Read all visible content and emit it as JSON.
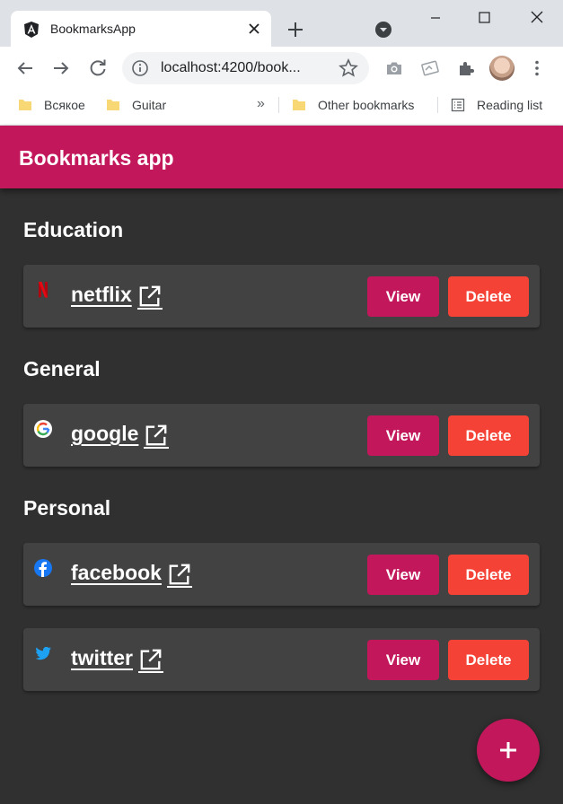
{
  "browser": {
    "tab_title": "BookmarksApp",
    "url": "localhost:4200/book...",
    "bookmarks_bar": [
      {
        "label": "Всякое",
        "icon": "folder-icon"
      },
      {
        "label": "Guitar",
        "icon": "folder-icon"
      },
      {
        "label": "Other bookmarks",
        "icon": "folder-icon"
      },
      {
        "label": "Reading list",
        "icon": "reading-list-icon"
      }
    ],
    "overflow_label": "»"
  },
  "app": {
    "title": "Bookmarks app",
    "colors": {
      "primary": "#c2185b",
      "warn": "#f44336",
      "background": "#303030",
      "card": "#424242"
    },
    "sections": [
      {
        "title": "Education",
        "items": [
          {
            "name": "netflix",
            "icon": "netflix-icon"
          }
        ]
      },
      {
        "title": "General",
        "items": [
          {
            "name": "google",
            "icon": "google-icon"
          }
        ]
      },
      {
        "title": "Personal",
        "items": [
          {
            "name": "facebook",
            "icon": "facebook-icon"
          },
          {
            "name": "twitter",
            "icon": "twitter-icon"
          }
        ]
      }
    ],
    "view_label": "View",
    "delete_label": "Delete",
    "fab_icon": "plus-icon"
  }
}
